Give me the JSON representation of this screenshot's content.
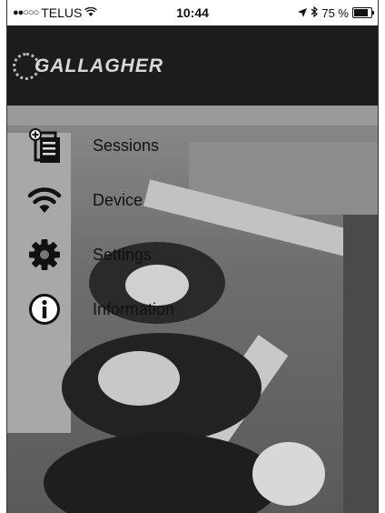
{
  "status_bar": {
    "signal": "●●○○○",
    "carrier": "TELUS",
    "wifi_icon": "wifi-icon",
    "time": "10:44",
    "location_icon": "location-arrow-icon",
    "bluetooth_icon": "bluetooth-icon",
    "battery": "75 %",
    "battery_level": 0.75
  },
  "header": {
    "logo_text": "GALLAGHER"
  },
  "menu": {
    "items": [
      {
        "label": "Sessions",
        "icon": "sessions-document-icon"
      },
      {
        "label": "Device",
        "icon": "wifi-icon"
      },
      {
        "label": "Settings",
        "icon": "gear-icon"
      },
      {
        "label": "Information",
        "icon": "info-icon"
      }
    ]
  },
  "colors": {
    "header_bg": "#1c1c1c",
    "text": "#111111"
  }
}
